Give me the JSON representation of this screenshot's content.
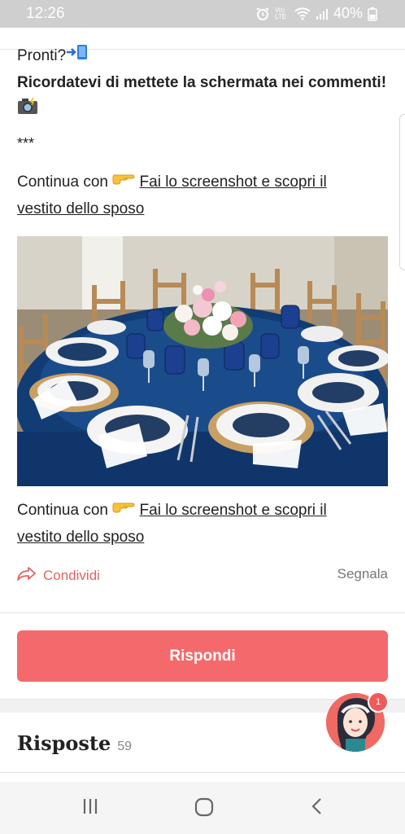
{
  "status_bar": {
    "time": "12:26",
    "network_label": "Vo) LTE",
    "battery": "40%"
  },
  "post": {
    "intro_line": "Pronti?",
    "instruction": "Ricordatevi di mettete la schermata nei commenti!",
    "separator": "***",
    "continue_prefix": "Continua con",
    "continue_link_1": "Fai lo screenshot e scopri il",
    "continue_link_2": "vestito dello sposo"
  },
  "actions": {
    "share_label": "Condividi",
    "report_label": "Segnala"
  },
  "reply_button": "Rispondi",
  "answers": {
    "title": "Risposte",
    "count": "59"
  },
  "chat_badge": "1",
  "colors": {
    "accent": "#f46a6c",
    "share_text": "#e5625f",
    "status_bar": "#cfcfcf"
  }
}
